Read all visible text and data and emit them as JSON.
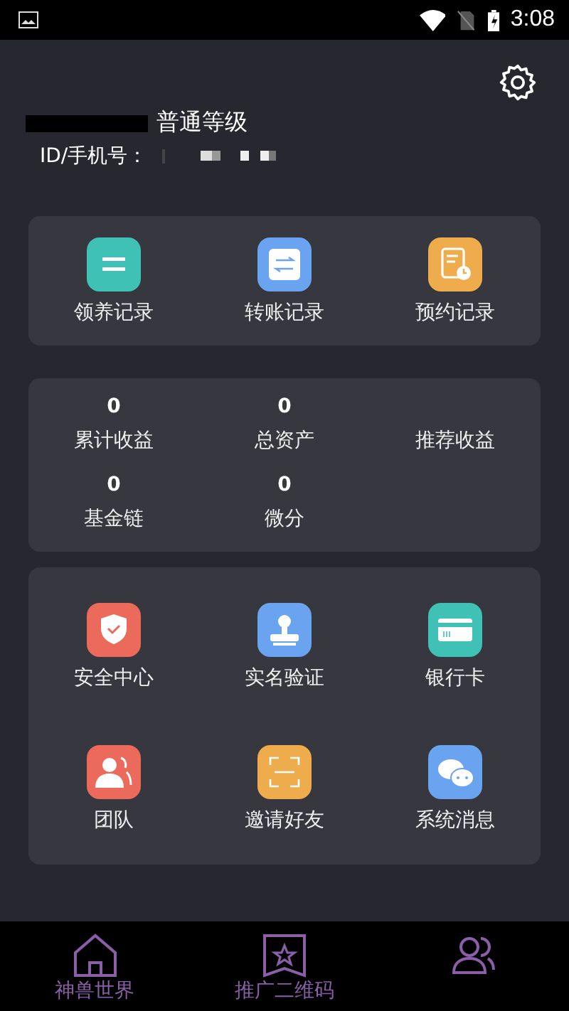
{
  "status_bar": {
    "time": "3:08"
  },
  "profile": {
    "level": "普通等级",
    "id_label": "ID/手机号："
  },
  "records": [
    {
      "label": "领养记录"
    },
    {
      "label": "转账记录"
    },
    {
      "label": "预约记录"
    }
  ],
  "stats": [
    {
      "value": "0",
      "label": "累计收益"
    },
    {
      "value": "0",
      "label": "总资产"
    },
    {
      "label": "推荐收益"
    },
    {
      "value": "0",
      "label": "基金链"
    },
    {
      "value": "0",
      "label": "微分"
    }
  ],
  "services": [
    {
      "label": "安全中心"
    },
    {
      "label": "实名验证"
    },
    {
      "label": "银行卡"
    },
    {
      "label": "团队"
    },
    {
      "label": "邀请好友"
    },
    {
      "label": "系统消息"
    }
  ],
  "bottom_nav": [
    {
      "label": "神兽世界"
    },
    {
      "label": "推广二维码"
    }
  ]
}
